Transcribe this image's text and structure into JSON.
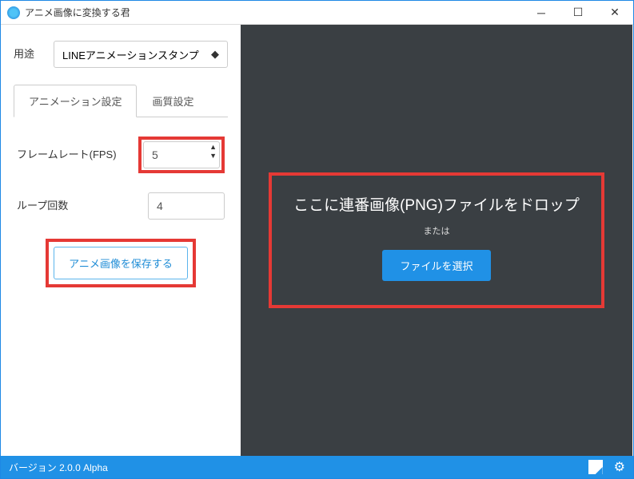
{
  "window": {
    "title": "アニメ画像に変換する君"
  },
  "purpose": {
    "label": "用途",
    "selected": "LINEアニメーションスタンプ"
  },
  "tabs": {
    "animation": "アニメーション設定",
    "quality": "画質設定"
  },
  "framerate": {
    "label": "フレームレート(FPS)",
    "value": "5"
  },
  "loop": {
    "label": "ループ回数",
    "value": "4"
  },
  "saveButton": "アニメ画像を保存する",
  "dropArea": {
    "title": "ここに連番画像(PNG)ファイルをドロップ",
    "or": "または",
    "button": "ファイルを選択"
  },
  "footer": {
    "version": "バージョン 2.0.0 Alpha"
  }
}
